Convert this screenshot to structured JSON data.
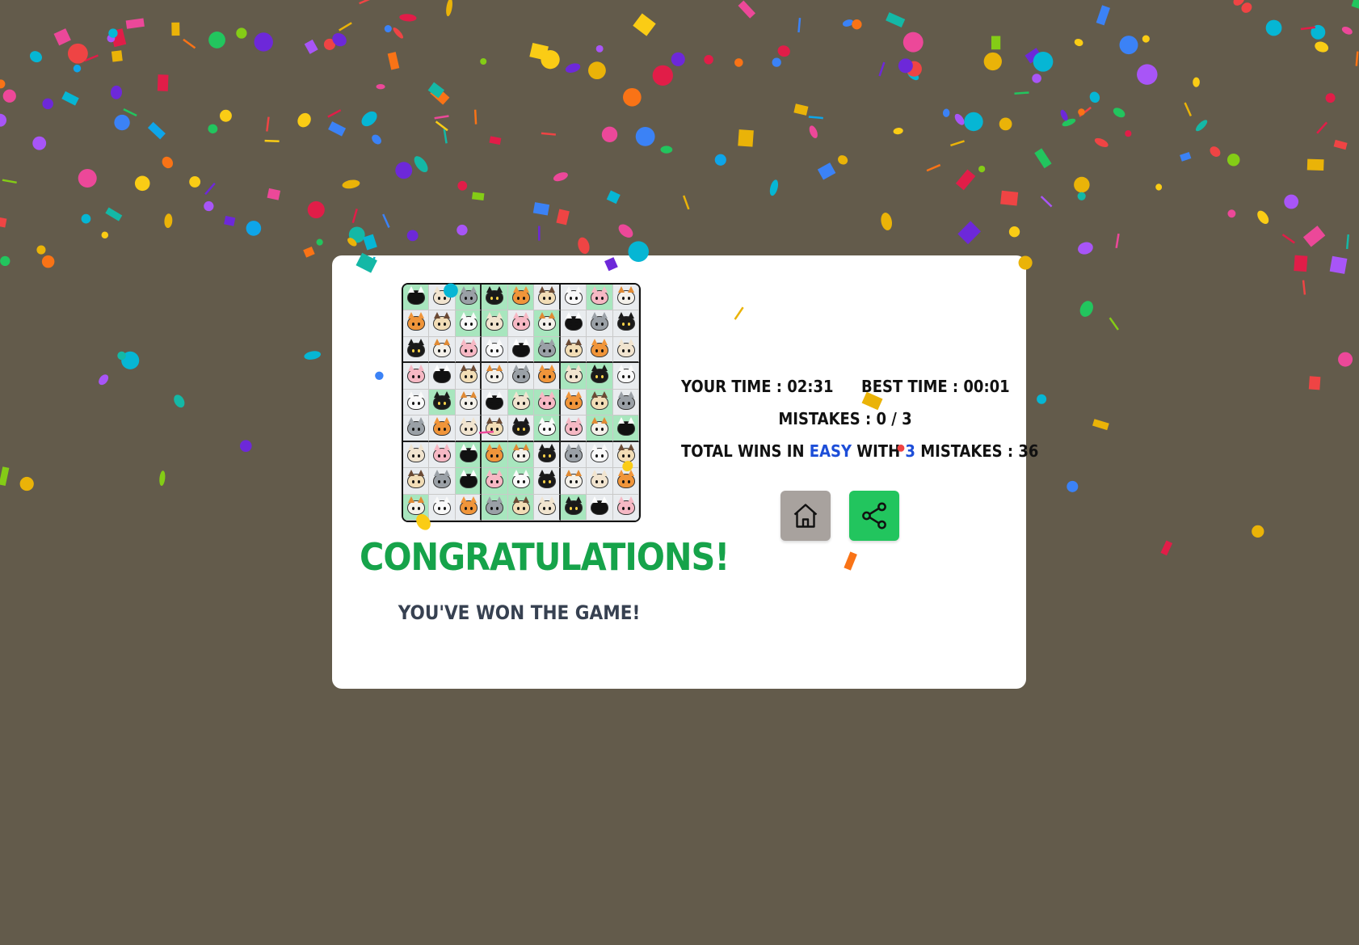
{
  "result": {
    "title": "CONGRATULATIONS!",
    "subtitle": "YOU'VE WON THE GAME!"
  },
  "stats": {
    "your_time_label": "YOUR TIME :",
    "your_time": "02:31",
    "best_time_label": "BEST TIME :",
    "best_time": "00:01",
    "mistakes_label": "MISTAKES :",
    "mistakes": "0 / 3",
    "total_wins_prefix": "TOTAL WINS IN",
    "difficulty": "EASY",
    "with_label": "WITH",
    "mistake_limit": "3",
    "mistakes_suffix": "MISTAKES :",
    "total_wins": "36"
  },
  "buttons": {
    "home_icon": "home-icon",
    "share_icon": "share-icon"
  },
  "board": {
    "cats": [
      [
        "tux",
        "cream",
        "gray",
        "black",
        "orange",
        "pug",
        "white",
        "pink",
        "calico"
      ],
      [
        "orange",
        "pug",
        "white",
        "cream",
        "pink",
        "calico",
        "tux",
        "gray",
        "black"
      ],
      [
        "black",
        "calico",
        "pink",
        "white",
        "tux",
        "gray",
        "pug",
        "orange",
        "cream"
      ],
      [
        "pink",
        "tux",
        "pug",
        "calico",
        "gray",
        "orange",
        "cream",
        "black",
        "white"
      ],
      [
        "white",
        "black",
        "calico",
        "tux",
        "cream",
        "pink",
        "orange",
        "pug",
        "gray"
      ],
      [
        "gray",
        "orange",
        "cream",
        "pug",
        "black",
        "white",
        "pink",
        "calico",
        "tux"
      ],
      [
        "cream",
        "pink",
        "tux",
        "orange",
        "calico",
        "black",
        "gray",
        "white",
        "pug"
      ],
      [
        "pug",
        "gray",
        "tux",
        "pink",
        "white",
        "black",
        "calico",
        "cream",
        "orange"
      ],
      [
        "calico",
        "white",
        "orange",
        "gray",
        "pug",
        "cream",
        "black",
        "tux",
        "pink"
      ]
    ],
    "shade": [
      "gwgggwwgw",
      "wwggwgwww",
      "wwwwwgwww",
      "wwwwwwggw",
      "wgwwggwgw",
      "wwwwwgwgg",
      "wwgggwwww",
      "wwgggwwww",
      "gwwggwgww"
    ]
  },
  "colors": {
    "background": "#635b4b",
    "title": "#16a34a",
    "accent": "#1d4ed8",
    "home": "#a8a29e",
    "share": "#22c55e"
  }
}
